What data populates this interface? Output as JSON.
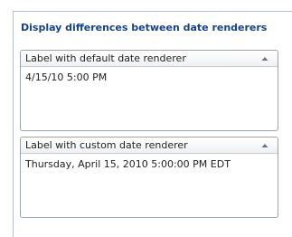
{
  "section": {
    "heading": "Display differences between date renderers"
  },
  "panels": [
    {
      "title": "Label with default date renderer",
      "value": "4/15/10 5:00 PM",
      "tool_icon": "collapse-up-icon"
    },
    {
      "title": "Label with custom date renderer",
      "value": "Thursday, April 15, 2010 5:00:00 PM EDT",
      "tool_icon": "collapse-up-icon"
    }
  ],
  "colors": {
    "heading_text": "#15428b",
    "panel_border": "#99a4b0",
    "frame_border": "#b9c0c8"
  }
}
